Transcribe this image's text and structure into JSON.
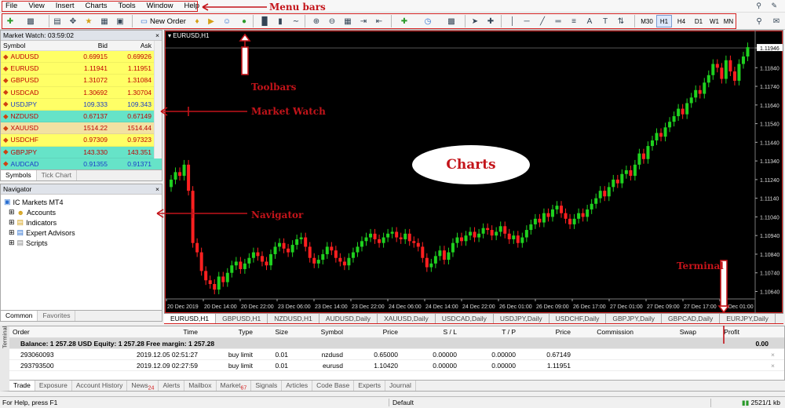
{
  "menu": {
    "items": [
      "File",
      "View",
      "Insert",
      "Charts",
      "Tools",
      "Window",
      "Help"
    ]
  },
  "toolbar": {
    "new_order": "New Order",
    "timeframes": [
      "M30",
      "H1",
      "H4",
      "D1",
      "W1",
      "MN"
    ],
    "active_timeframe": "H1"
  },
  "market_watch": {
    "title": "Market Watch: 03:59:02",
    "columns": [
      "Symbol",
      "Bid",
      "Ask"
    ],
    "rows": [
      {
        "symbol": "AUDUSD",
        "bid": "0.69915",
        "ask": "0.69926",
        "color": "#ffff66",
        "text": "#c00000"
      },
      {
        "symbol": "EURUSD",
        "bid": "1.11941",
        "ask": "1.11951",
        "color": "#ffff66",
        "text": "#c00000"
      },
      {
        "symbol": "GBPUSD",
        "bid": "1.31072",
        "ask": "1.31084",
        "color": "#ffff66",
        "text": "#c00000"
      },
      {
        "symbol": "USDCAD",
        "bid": "1.30692",
        "ask": "1.30704",
        "color": "#ffff66",
        "text": "#c00000"
      },
      {
        "symbol": "USDJPY",
        "bid": "109.333",
        "ask": "109.343",
        "color": "#ffff66",
        "text": "#1a3cc8"
      },
      {
        "symbol": "NZDUSD",
        "bid": "0.67137",
        "ask": "0.67149",
        "color": "#66e3c8",
        "text": "#c00000"
      },
      {
        "symbol": "XAUUSD",
        "bid": "1514.22",
        "ask": "1514.44",
        "color": "#f2e1a2",
        "text": "#c00000"
      },
      {
        "symbol": "USDCHF",
        "bid": "0.97309",
        "ask": "0.97323",
        "color": "#ffff66",
        "text": "#c00000"
      },
      {
        "symbol": "GBPJPY",
        "bid": "143.330",
        "ask": "143.351",
        "color": "#66e3c8",
        "text": "#c00000"
      },
      {
        "symbol": "AUDCAD",
        "bid": "0.91355",
        "ask": "0.91371",
        "color": "#66e3c8",
        "text": "#1a3cc8"
      }
    ],
    "tabs": [
      "Symbols",
      "Tick Chart"
    ]
  },
  "navigator": {
    "title": "Navigator",
    "root": "IC Markets MT4",
    "items": [
      "Accounts",
      "Indicators",
      "Expert Advisors",
      "Scripts"
    ],
    "tabs": [
      "Common",
      "Favorites"
    ]
  },
  "chart": {
    "label": "EURUSD,H1",
    "price_labels": [
      "1.11946",
      "1.11840",
      "1.11740",
      "1.11640",
      "1.11540",
      "1.11440",
      "1.11340",
      "1.11240",
      "1.11140",
      "1.11040",
      "1.10940",
      "1.10840",
      "1.10740",
      "1.10640"
    ],
    "current_price": "1.11946",
    "time_labels": [
      "20 Dec 2019",
      "20 Dec 14:00",
      "20 Dec 22:00",
      "23 Dec 06:00",
      "23 Dec 14:00",
      "23 Dec 22:00",
      "24 Dec 06:00",
      "24 Dec 14:00",
      "24 Dec 22:00",
      "26 Dec 01:00",
      "26 Dec 09:00",
      "26 Dec 17:00",
      "27 Dec 01:00",
      "27 Dec 09:00",
      "27 Dec 17:00",
      "30 Dec 01:00"
    ],
    "tabs": [
      "EURUSD,H1",
      "GBPUSD,H1",
      "NZDUSD,H1",
      "AUDUSD,Daily",
      "XAUUSD,Daily",
      "USDCAD,Daily",
      "USDJPY,Daily",
      "USDCHF,Daily",
      "GBPJPY,Daily",
      "GBPCAD,Daily",
      "EURJPY,Daily"
    ],
    "colors": {
      "bull": "#1fd11f",
      "bear": "#ff2020",
      "bg": "#000000"
    }
  },
  "chart_data": {
    "type": "candlestick",
    "close": [
      1.1124,
      1.1128,
      1.1126,
      1.1132,
      1.1118,
      1.109,
      1.1085,
      1.1075,
      1.107,
      1.1068,
      1.1065,
      1.1072,
      1.1069,
      1.1074,
      1.1078,
      1.108,
      1.1076,
      1.1079,
      1.1082,
      1.1085,
      1.1083,
      1.108,
      1.1078,
      1.1084,
      1.1088,
      1.109,
      1.1087,
      1.1085,
      1.1089,
      1.1092,
      1.1093,
      1.1088,
      1.1082,
      1.1079,
      1.1081,
      1.1084,
      1.1088,
      1.1086,
      1.1082,
      1.108,
      1.1078,
      1.1082,
      1.1085,
      1.1088,
      1.1091,
      1.1093,
      1.1095,
      1.1092,
      1.109,
      1.1093,
      1.1095,
      1.1096,
      1.1093,
      1.1092,
      1.1095,
      1.1091,
      1.109,
      1.1088,
      1.1082,
      1.1077,
      1.1079,
      1.1083,
      1.1086,
      1.1081,
      1.1085,
      1.109,
      1.1093,
      1.1091,
      1.1094,
      1.1096,
      1.1093,
      1.1095,
      1.1098,
      1.1097,
      1.1094,
      1.1096,
      1.1099,
      1.1095,
      1.1092,
      1.1094,
      1.109,
      1.1093,
      1.1097,
      1.11,
      1.1103,
      1.1101,
      1.1106,
      1.1104,
      1.1108,
      1.111,
      1.1106,
      1.1103,
      1.11,
      1.1103,
      1.1106,
      1.1104,
      1.1108,
      1.1111,
      1.1114,
      1.1118,
      1.1115,
      1.112,
      1.1124,
      1.1122,
      1.1127,
      1.1129,
      1.1126,
      1.1132,
      1.1138,
      1.1135,
      1.1142,
      1.1145,
      1.1149,
      1.1147,
      1.1152,
      1.1155,
      1.1158,
      1.1162,
      1.1159,
      1.1165,
      1.1168,
      1.1172,
      1.117,
      1.1176,
      1.118,
      1.1186,
      1.1184,
      1.1178,
      1.1188,
      1.1182,
      1.1177,
      1.1186,
      1.119,
      1.1195
    ]
  },
  "terminal": {
    "columns": [
      "Order",
      "Time",
      "Type",
      "Size",
      "Symbol",
      "Price",
      "S / L",
      "T / P",
      "Price",
      "Commission",
      "Swap",
      "Profit"
    ],
    "balance": "Balance: 1 257.28 USD  Equity: 1 257.28  Free margin: 1 257.28",
    "balance_profit": "0.00",
    "rows": [
      {
        "order": "293060093",
        "time": "2019.12.05 02:51:27",
        "type": "buy limit",
        "size": "0.01",
        "symbol": "nzdusd",
        "price": "0.65000",
        "sl": "0.00000",
        "tp": "0.00000",
        "cur": "0.67149"
      },
      {
        "order": "293793500",
        "time": "2019.12.09 02:27:59",
        "type": "buy limit",
        "size": "0.01",
        "symbol": "eurusd",
        "price": "1.10420",
        "sl": "0.00000",
        "tp": "0.00000",
        "cur": "1.11951"
      }
    ],
    "side_label": "Terminal",
    "tabs": [
      {
        "label": "Trade",
        "badge": ""
      },
      {
        "label": "Exposure",
        "badge": ""
      },
      {
        "label": "Account History",
        "badge": ""
      },
      {
        "label": "News",
        "badge": "24"
      },
      {
        "label": "Alerts",
        "badge": ""
      },
      {
        "label": "Mailbox",
        "badge": ""
      },
      {
        "label": "Market",
        "badge": "67"
      },
      {
        "label": "Signals",
        "badge": ""
      },
      {
        "label": "Articles",
        "badge": ""
      },
      {
        "label": "Code Base",
        "badge": ""
      },
      {
        "label": "Experts",
        "badge": ""
      },
      {
        "label": "Journal",
        "badge": ""
      }
    ]
  },
  "status": {
    "help": "For Help, press F1",
    "profile": "Default",
    "traffic": "2521/1 kb"
  },
  "annotations": {
    "menu_bars": "Menu bars",
    "toolbars": "Toolbars",
    "market_watch": "Market Watch",
    "navigator": "Navigator",
    "charts": "Charts",
    "terminal": "Terminal"
  }
}
